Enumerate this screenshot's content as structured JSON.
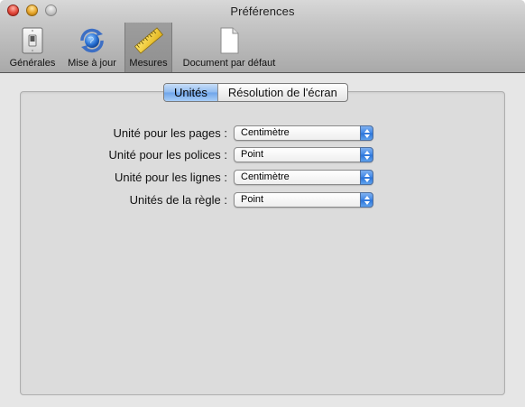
{
  "window": {
    "title": "Préférences"
  },
  "toolbar": {
    "items": [
      {
        "label": "Générales",
        "icon": "light-switch-icon",
        "selected": false
      },
      {
        "label": "Mise à jour",
        "icon": "software-update-globe-icon",
        "selected": false
      },
      {
        "label": "Mesures",
        "icon": "ruler-icon",
        "selected": true
      },
      {
        "label": "Document par défaut",
        "icon": "blank-document-icon",
        "selected": false
      }
    ]
  },
  "tabs": {
    "units": "Unités",
    "resolution": "Résolution de l'écran",
    "active": "units"
  },
  "form": {
    "page_units": {
      "label": "Unité pour les pages :",
      "value": "Centimètre"
    },
    "font_units": {
      "label": "Unité pour les polices :",
      "value": "Point"
    },
    "line_units": {
      "label": "Unité pour les lignes :",
      "value": "Centimètre"
    },
    "ruler_units": {
      "label": "Unités de la règle :",
      "value": "Point"
    }
  },
  "colors": {
    "accent": "#3f86e6",
    "toolbar_top": "#d8d8d8",
    "toolbar_bottom": "#a9a9a9",
    "panel": "#dcdcdc"
  }
}
